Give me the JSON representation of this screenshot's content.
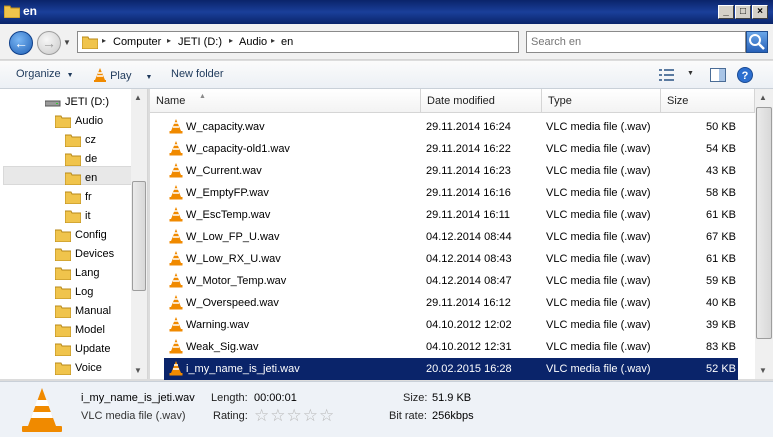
{
  "window": {
    "title": "en"
  },
  "address": {
    "crumbs": [
      "Computer",
      "JETI (D:)",
      "Audio",
      "en"
    ],
    "search_placeholder": "Search en"
  },
  "toolbar": {
    "organize": "Organize",
    "play": "Play",
    "new_folder": "New folder"
  },
  "nav": {
    "drive": "JETI (D:)",
    "audio": "Audio",
    "subfolders": [
      "cz",
      "de",
      "en",
      "fr",
      "it"
    ],
    "folders": [
      "Config",
      "Devices",
      "Lang",
      "Log",
      "Manual",
      "Model",
      "Update",
      "Voice"
    ],
    "selected": "en"
  },
  "columns": {
    "name": "Name",
    "date": "Date modified",
    "type": "Type",
    "size": "Size"
  },
  "files": [
    {
      "name": "W_capacity.wav",
      "date": "29.11.2014 16:24",
      "type": "VLC media file (.wav)",
      "size": "50 KB"
    },
    {
      "name": "W_capacity-old1.wav",
      "date": "29.11.2014 16:22",
      "type": "VLC media file (.wav)",
      "size": "54 KB"
    },
    {
      "name": "W_Current.wav",
      "date": "29.11.2014 16:23",
      "type": "VLC media file (.wav)",
      "size": "43 KB"
    },
    {
      "name": "W_EmptyFP.wav",
      "date": "29.11.2014 16:16",
      "type": "VLC media file (.wav)",
      "size": "58 KB"
    },
    {
      "name": "W_EscTemp.wav",
      "date": "29.11.2014 16:11",
      "type": "VLC media file (.wav)",
      "size": "61 KB"
    },
    {
      "name": "W_Low_FP_U.wav",
      "date": "04.12.2014 08:44",
      "type": "VLC media file (.wav)",
      "size": "67 KB"
    },
    {
      "name": "W_Low_RX_U.wav",
      "date": "04.12.2014 08:43",
      "type": "VLC media file (.wav)",
      "size": "61 KB"
    },
    {
      "name": "W_Motor_Temp.wav",
      "date": "04.12.2014 08:47",
      "type": "VLC media file (.wav)",
      "size": "59 KB"
    },
    {
      "name": "W_Overspeed.wav",
      "date": "29.11.2014 16:12",
      "type": "VLC media file (.wav)",
      "size": "40 KB"
    },
    {
      "name": "Warning.wav",
      "date": "04.10.2012 12:02",
      "type": "VLC media file (.wav)",
      "size": "39 KB"
    },
    {
      "name": "Weak_Sig.wav",
      "date": "04.10.2012 12:31",
      "type": "VLC media file (.wav)",
      "size": "83 KB"
    },
    {
      "name": "i_my_name_is_jeti.wav",
      "date": "20.02.2015 16:28",
      "type": "VLC media file (.wav)",
      "size": "52 KB"
    }
  ],
  "selected_file_index": 11,
  "details": {
    "filename": "i_my_name_is_jeti.wav",
    "filetype": "VLC media file (.wav)",
    "length_label": "Length:",
    "length": "00:00:01",
    "rating_label": "Rating:",
    "rating_stars": 0,
    "size_label": "Size:",
    "size": "51.9 KB",
    "bitrate_label": "Bit rate:",
    "bitrate": "256kbps"
  },
  "colors": {
    "selection": "#0a246a",
    "titlebar": "#0a246a",
    "folder": "#f0c44c",
    "vlc_orange": "#f08a00"
  }
}
